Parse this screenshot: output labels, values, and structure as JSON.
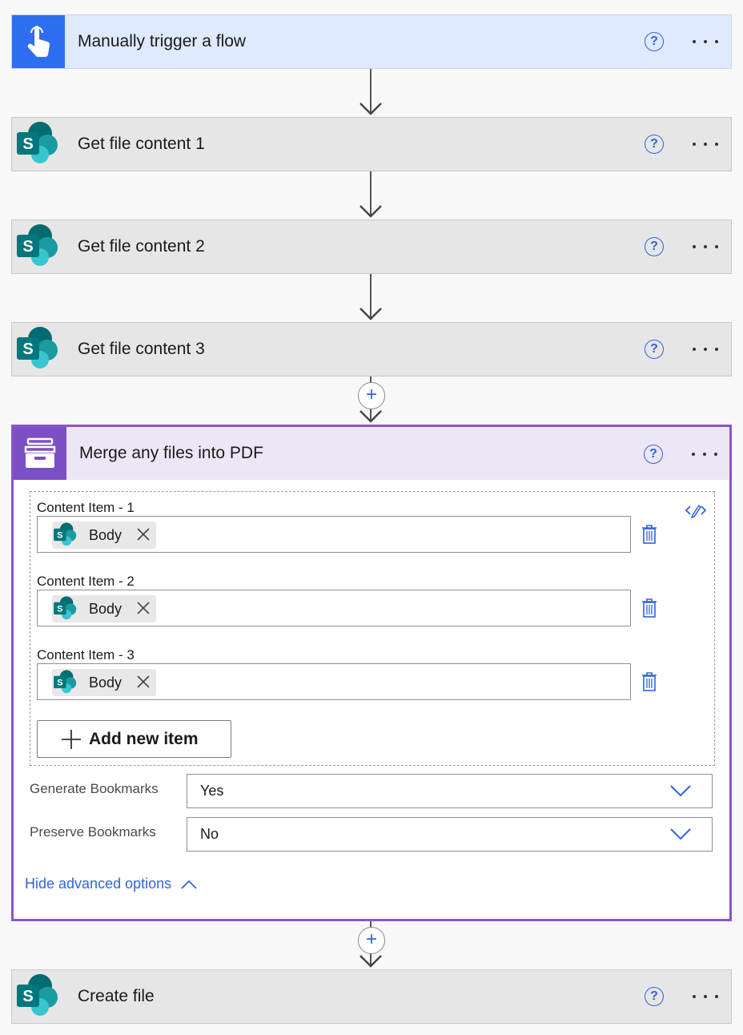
{
  "steps": {
    "trigger": {
      "title": "Manually trigger a flow"
    },
    "get1": {
      "title": "Get file content 1"
    },
    "get2": {
      "title": "Get file content 2"
    },
    "get3": {
      "title": "Get file content 3"
    },
    "create": {
      "title": "Create file"
    }
  },
  "merge": {
    "title": "Merge any files into PDF",
    "items": [
      {
        "label": "Content Item - 1",
        "token": "Body"
      },
      {
        "label": "Content Item - 2",
        "token": "Body"
      },
      {
        "label": "Content Item - 3",
        "token": "Body"
      }
    ],
    "add_label": "Add new item",
    "generate_label": "Generate Bookmarks",
    "generate_value": "Yes",
    "preserve_label": "Preserve Bookmarks",
    "preserve_value": "No",
    "hide_advanced": "Hide advanced options"
  },
  "help_glyph": "?",
  "plus_glyph": "+",
  "colors": {
    "trigger_accent": "#2e6ef0",
    "merge_accent": "#7c4fc4",
    "link_blue": "#2f64d8",
    "sharepoint_teal": "#0b6a6a"
  },
  "icons": [
    "hand-pointer-icon",
    "sharepoint-icon",
    "help-icon",
    "more-icon",
    "plus-icon",
    "trash-icon",
    "edit-code-icon",
    "close-icon",
    "chevron-down-icon",
    "chevron-up-icon",
    "cabinet-icon"
  ]
}
